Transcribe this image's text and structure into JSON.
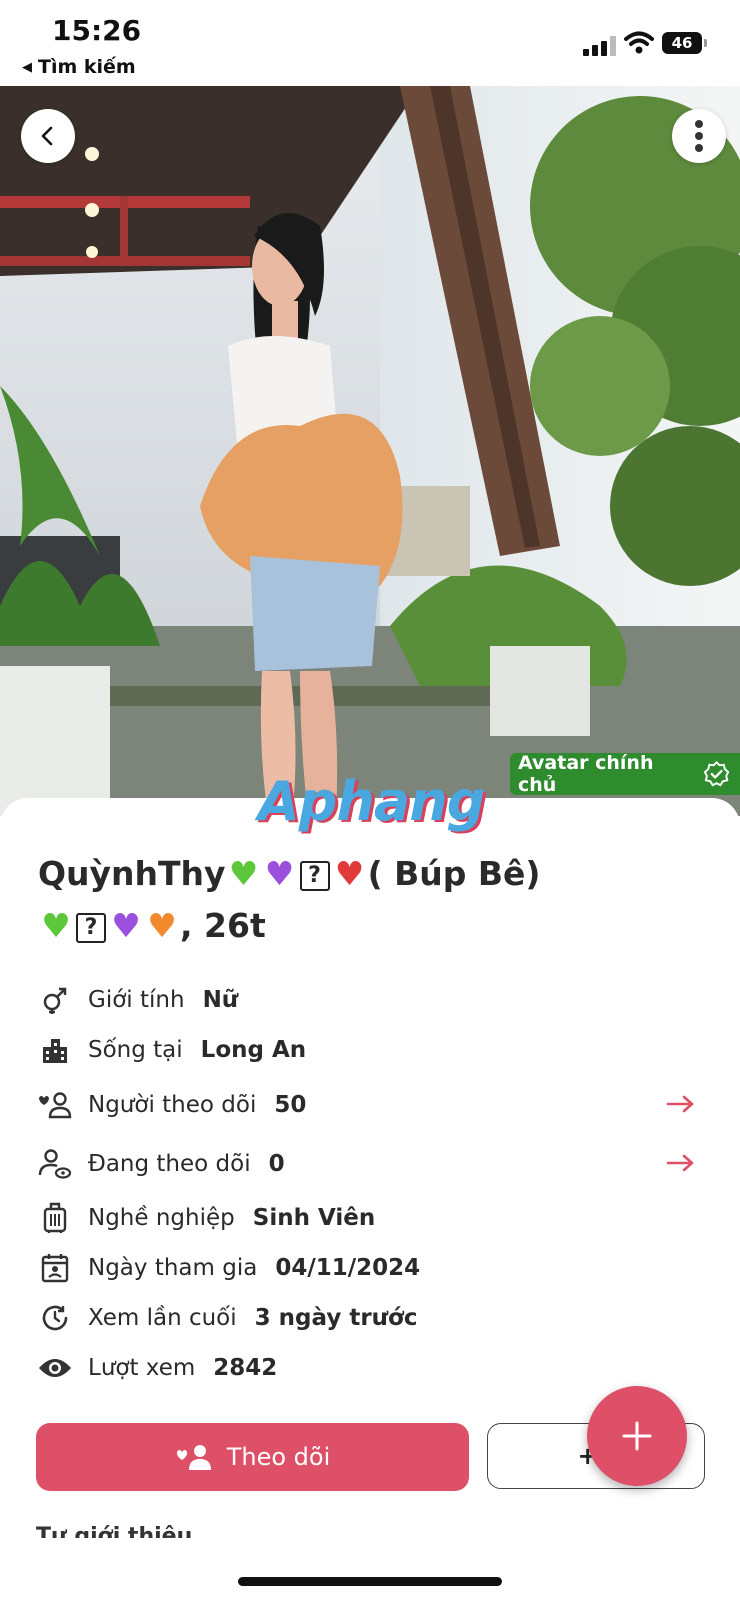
{
  "status": {
    "time": "15:26",
    "back_label": "Tìm kiếm",
    "battery": "46"
  },
  "photo": {
    "badge_label": "Avatar chính chủ",
    "watermark": "Aphang"
  },
  "profile": {
    "name_text": "QuỳnhThy",
    "name_suffix": "( Búp Bê)",
    "age": ", 26t",
    "fields": [
      {
        "icon": "gender-icon",
        "label": "Giới tính",
        "value": "Nữ"
      },
      {
        "icon": "city-icon",
        "label": "Sống tại",
        "value": "Long An"
      },
      {
        "icon": "followers-icon",
        "label": "Người theo dõi",
        "value": "50"
      },
      {
        "icon": "following-icon",
        "label": "Đang theo dõi",
        "value": "0"
      },
      {
        "icon": "job-icon",
        "label": "Nghề nghiệp",
        "value": "Sinh Viên"
      },
      {
        "icon": "calendar-icon",
        "label": "Ngày tham gia",
        "value": "04/11/2024"
      },
      {
        "icon": "history-icon",
        "label": "Xem lần cuối",
        "value": "3 ngày trước"
      },
      {
        "icon": "eye-icon",
        "label": "Lượt xem",
        "value": "2842"
      }
    ]
  },
  "actions": {
    "follow_label": "Theo dõi",
    "secondary_label": "+2",
    "fab_icon": "plus-icon"
  },
  "section": {
    "intro_title": "Tự giới thiệu"
  },
  "colors": {
    "accent": "#de5067",
    "verified": "#2e8b2e"
  }
}
